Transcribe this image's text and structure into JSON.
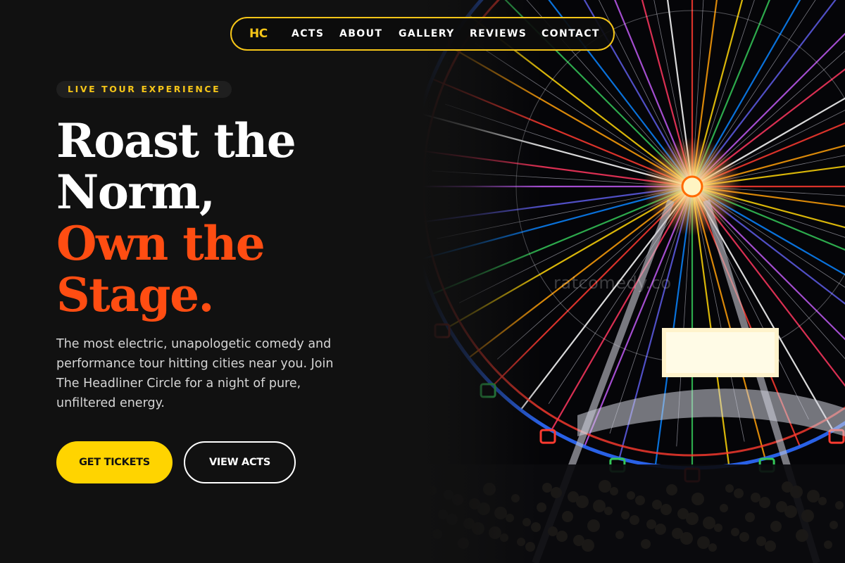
{
  "nav": {
    "logo": "HC",
    "links": [
      "ACTS",
      "ABOUT",
      "GALLERY",
      "REVIEWS",
      "CONTACT"
    ]
  },
  "hero": {
    "eyebrow": "LIVE TOUR EXPERIENCE",
    "headline_line1": "Roast the",
    "headline_line2": "Norm,",
    "headline_line3": "Own the",
    "headline_line4": "Stage.",
    "description": "The most electric, unapologetic comedy and performance tour hitting cities near you. Join The Headliner Circle for a night of pure, unfiltered energy.",
    "primary_button": "GET TICKETS",
    "secondary_button": "VIEW ACTS"
  },
  "photo": {
    "subject": "ferris-wheel-night-concert",
    "watermark": "ratcomedy.co"
  },
  "colors": {
    "background": "#111111",
    "brand_yellow": "#f5c518",
    "button_yellow": "#ffd400",
    "accent_orange": "#ff4d12",
    "text_white": "#ffffff",
    "body_text": "#d6d6d6"
  }
}
